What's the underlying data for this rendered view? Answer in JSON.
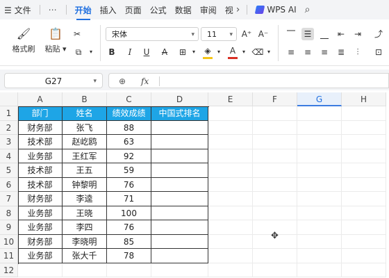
{
  "menubar": {
    "file_label": "文件",
    "more": "⋯",
    "tabs": [
      "开始",
      "插入",
      "页面",
      "公式",
      "数据",
      "审阅",
      "视"
    ],
    "active_tab": "开始",
    "wps_ai": "WPS AI"
  },
  "ribbon": {
    "format_painter": "格式刷",
    "paste": "粘贴",
    "font_name": "宋体",
    "font_size": "11",
    "colors": {
      "font_fill": "#f5c518",
      "font_color": "#d93025"
    }
  },
  "formula_bar": {
    "cell_ref": "G27",
    "fx": "fx",
    "value": ""
  },
  "sheet": {
    "columns": [
      "A",
      "B",
      "C",
      "D",
      "E",
      "F",
      "G",
      "H"
    ],
    "active_column": "G",
    "rows": [
      "1",
      "2",
      "3",
      "4",
      "5",
      "6",
      "7",
      "8",
      "9",
      "10",
      "11",
      "12"
    ],
    "header_color": "#1ea5e6",
    "table": {
      "headers": [
        "部门",
        "姓名",
        "绩效成绩",
        "中国式排名"
      ],
      "rows": [
        [
          "财务部",
          "张飞",
          "88",
          ""
        ],
        [
          "技术部",
          "赵屹鸥",
          "63",
          ""
        ],
        [
          "业务部",
          "王红军",
          "92",
          ""
        ],
        [
          "技术部",
          "王五",
          "59",
          ""
        ],
        [
          "技术部",
          "钟黎明",
          "76",
          ""
        ],
        [
          "财务部",
          "李逵",
          "71",
          ""
        ],
        [
          "业务部",
          "王晓",
          "100",
          ""
        ],
        [
          "业务部",
          "李四",
          "76",
          ""
        ],
        [
          "财务部",
          "李晓明",
          "85",
          ""
        ],
        [
          "业务部",
          "张大千",
          "78",
          ""
        ]
      ]
    }
  }
}
